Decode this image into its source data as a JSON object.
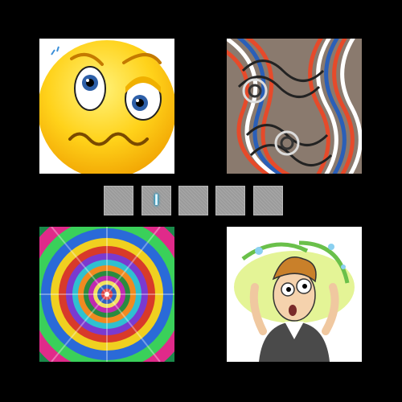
{
  "puzzle": {
    "images": [
      {
        "subject": "worried-emoji-face"
      },
      {
        "subject": "wavy-optical-illusion"
      },
      {
        "subject": "psychedelic-spiral"
      },
      {
        "subject": "dizzy-cartoon-man"
      }
    ],
    "answer_slots": [
      "",
      "I",
      "",
      "",
      ""
    ],
    "slot_color": "#9b9b9b",
    "letter_glow_color": "#1aa6d6",
    "background_color": "#000000"
  }
}
